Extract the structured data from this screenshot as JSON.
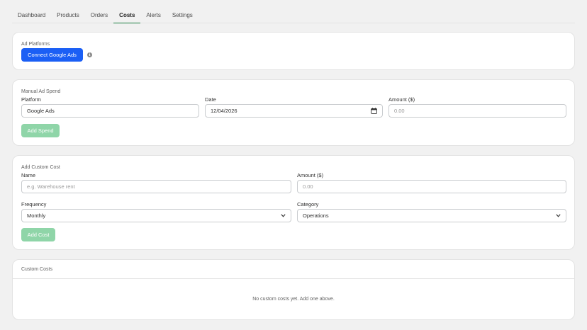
{
  "nav": {
    "tabs": [
      "Dashboard",
      "Products",
      "Orders",
      "Costs",
      "Alerts",
      "Settings"
    ],
    "active": "Costs"
  },
  "ad_platforms": {
    "title": "Ad Platforms",
    "connect_label": "Connect Google Ads",
    "info_glyph": "i"
  },
  "manual_spend": {
    "title": "Manual Ad Spend",
    "platform_label": "Platform",
    "platform_value": "Google Ads",
    "date_label": "Date",
    "date_value": "12/04/2026",
    "amount_label": "Amount ($)",
    "amount_placeholder": "0.00",
    "submit_label": "Add Spend"
  },
  "custom_cost": {
    "title": "Add Custom Cost",
    "name_label": "Name",
    "name_placeholder": "e.g. Warehouse rent",
    "amount_label": "Amount ($)",
    "amount_placeholder": "0.00",
    "frequency_label": "Frequency",
    "frequency_value": "Monthly",
    "category_label": "Category",
    "category_value": "Operations",
    "submit_label": "Add Cost"
  },
  "custom_costs_list": {
    "title": "Custom Costs",
    "empty_message": "No custom costs yet. Add one above."
  },
  "colors": {
    "accent": "#1b5ff5",
    "active_tab_underline": "#1a7a3e",
    "disabled_green": "#8fd5a8"
  }
}
